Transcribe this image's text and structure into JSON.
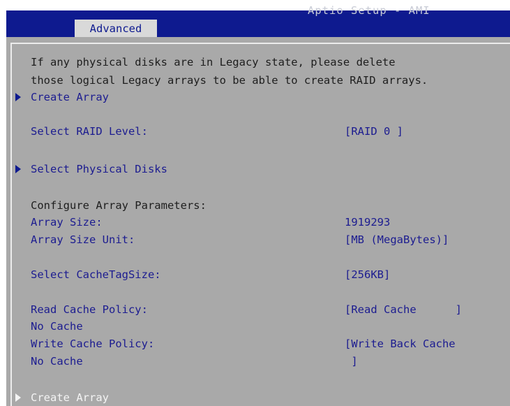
{
  "header": {
    "brand": "Aptio Setup - AMI",
    "tab_label": "Advanced"
  },
  "content": {
    "info_line1": "If any physical disks are in Legacy state, please delete",
    "info_line2": "those logical Legacy arrays to be able to create RAID arrays.",
    "create_array_top": "Create Array",
    "raid_level_label": "Select RAID Level:",
    "raid_level_value": "[RAID 0 ]",
    "select_disks": "Select Physical Disks",
    "configure_params": "Configure Array Parameters:",
    "array_size_label": "Array Size:",
    "array_size_value": "1919293",
    "array_size_unit_label": "Array Size Unit:",
    "array_size_unit_value": "[MB (MegaBytes)]",
    "cache_tag_label": "Select CacheTagSize:",
    "cache_tag_value": "[256KB]",
    "read_cache_label": "Read Cache Policy:",
    "read_cache_value": "[Read Cache      ]",
    "read_cache_sub": "No Cache",
    "write_cache_label": "Write Cache Policy:",
    "write_cache_value_line1": "[Write Back Cache",
    "write_cache_value_line2": " ]",
    "write_cache_sub": "No Cache",
    "create_array_bottom": "Create Array"
  },
  "colors": {
    "header_blue": "#0e1a8f",
    "panel_gray": "#a9a9a9",
    "text_blue": "#1c1c90",
    "highlight_white": "#f4f4f4"
  }
}
